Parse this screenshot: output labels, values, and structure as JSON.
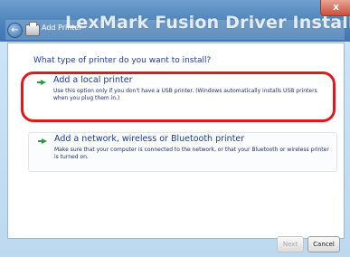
{
  "window": {
    "banner_title": "LexMark Fusion Driver Install",
    "wizard_title": "Add Printer",
    "close_glyph": "x"
  },
  "main": {
    "question": "What type of printer do you want to install?",
    "options": [
      {
        "title": "Add a local printer",
        "description": "Use this option only if you don't have a USB printer. (Windows automatically installs USB printers when you plug them in.)",
        "icon": "green-arrow-icon",
        "highlighted": true
      },
      {
        "title": "Add a network, wireless or Bluetooth printer",
        "description": "Make sure that your computer is connected to the network, or that your Bluetooth or wireless printer is turned on.",
        "icon": "green-arrow-icon",
        "highlighted": false
      }
    ]
  },
  "buttons": {
    "next_label": "Next",
    "cancel_label": "Cancel",
    "next_enabled": false
  },
  "colors": {
    "highlight_ring": "#e0191d",
    "link_text": "#1a3a9c",
    "arrow": "#2e9a3f"
  }
}
